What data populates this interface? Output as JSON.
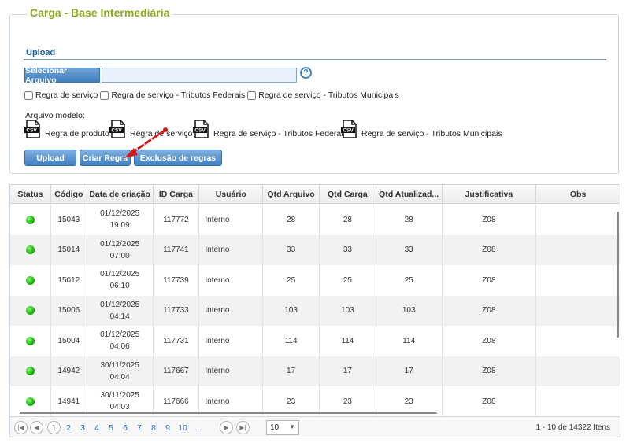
{
  "page": {
    "title": "Carga - Base Intermediária",
    "section": "Upload"
  },
  "upload": {
    "select_label": "Selecionar Arquivo",
    "file_value": "",
    "help": "?",
    "checkboxes": [
      "Regra de serviço",
      "Regra de serviço - Tributos Federais",
      "Regra de serviço - Tributos Municipais"
    ],
    "model_label": "Arquivo modelo:",
    "models": [
      "Regra de produto",
      "Regra de serviço",
      "Regra de serviço - Tributos Federais",
      "Regra de serviço - Tributos Municipais"
    ],
    "csv_text": "CSV",
    "buttons": {
      "upload": "Upload",
      "criar": "Criar Regra",
      "exclusao": "Exclusão de regras"
    }
  },
  "grid": {
    "columns": [
      "Status",
      "Código",
      "Data de criação",
      "ID Carga",
      "Usuário",
      "Qtd Arquivo",
      "Qtd Carga",
      "Qtd Atualizad...",
      "Justificativa",
      "Obs"
    ],
    "rows": [
      {
        "codigo": "15043",
        "data": "01/12/2025",
        "hora": "19:09",
        "id": "117772",
        "usuario": "Interno",
        "qa": "28",
        "qc": "28",
        "qu": "28",
        "just": "Z08",
        "obs": ""
      },
      {
        "codigo": "15014",
        "data": "01/12/2025",
        "hora": "07:00",
        "id": "117741",
        "usuario": "Interno",
        "qa": "33",
        "qc": "33",
        "qu": "33",
        "just": "Z08",
        "obs": ""
      },
      {
        "codigo": "15012",
        "data": "01/12/2025",
        "hora": "06:10",
        "id": "117739",
        "usuario": "Interno",
        "qa": "25",
        "qc": "25",
        "qu": "25",
        "just": "Z08",
        "obs": ""
      },
      {
        "codigo": "15006",
        "data": "01/12/2025",
        "hora": "04:14",
        "id": "117733",
        "usuario": "Interno",
        "qa": "103",
        "qc": "103",
        "qu": "103",
        "just": "Z08",
        "obs": ""
      },
      {
        "codigo": "15004",
        "data": "01/12/2025",
        "hora": "04:06",
        "id": "117731",
        "usuario": "Interno",
        "qa": "114",
        "qc": "114",
        "qu": "114",
        "just": "Z08",
        "obs": ""
      },
      {
        "codigo": "14942",
        "data": "30/11/2025",
        "hora": "04:04",
        "id": "117667",
        "usuario": "Interno",
        "qa": "17",
        "qc": "17",
        "qu": "17",
        "just": "Z08",
        "obs": ""
      },
      {
        "codigo": "14941",
        "data": "30/11/2025",
        "hora": "04:03",
        "id": "117666",
        "usuario": "Interno",
        "qa": "23",
        "qc": "23",
        "qu": "23",
        "just": "Z08",
        "obs": ""
      }
    ],
    "status_color": "#1ab10a"
  },
  "pager": {
    "pages": [
      "1",
      "2",
      "3",
      "4",
      "5",
      "6",
      "7",
      "8",
      "9",
      "10",
      "..."
    ],
    "current": "1",
    "page_size": "10",
    "info": "1 - 10 de 14322 Itens",
    "icons": [
      "first-page-icon",
      "prev-page-icon",
      "next-page-icon",
      "last-page-icon"
    ]
  },
  "colors": {
    "title": "#8aab1b",
    "accent": "#3f7fc0",
    "arrow": "#d11a1a"
  }
}
